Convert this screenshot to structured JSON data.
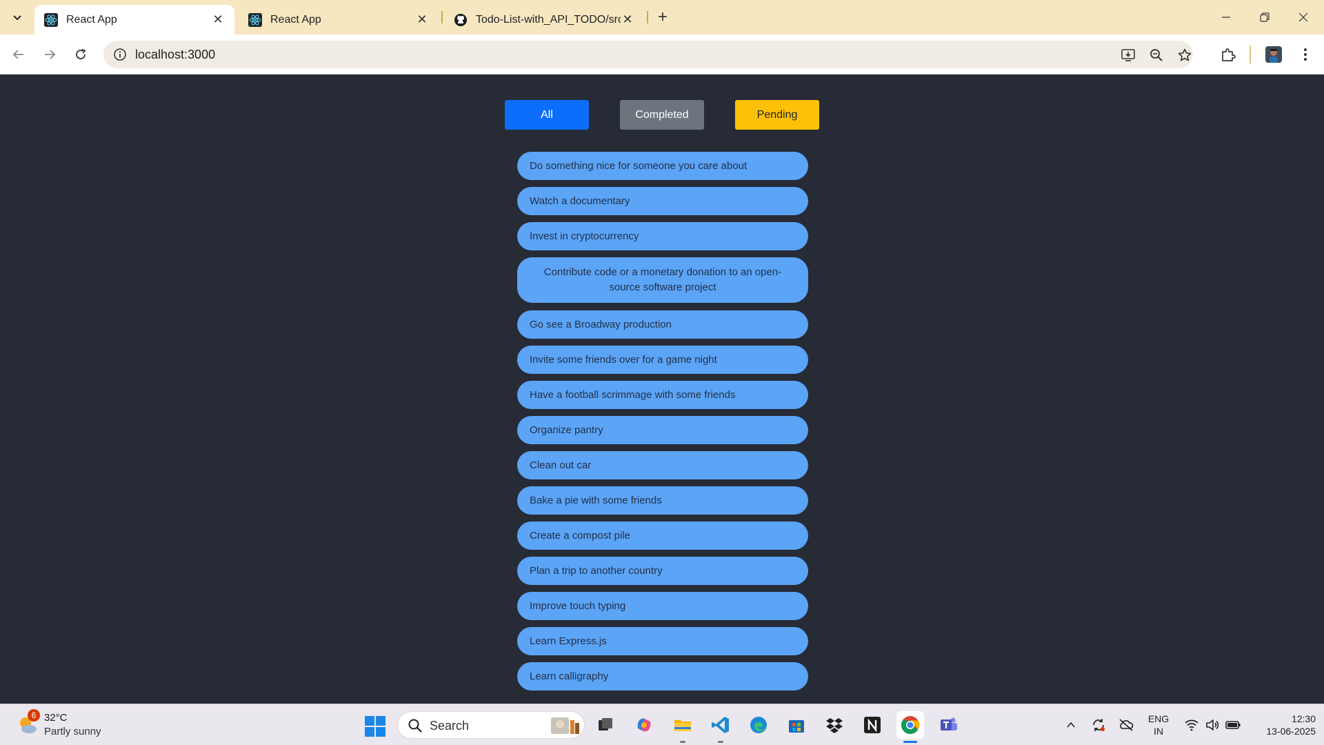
{
  "browser": {
    "tabs": [
      {
        "title": "React App",
        "icon": "react-icon",
        "active": true
      },
      {
        "title": "React App",
        "icon": "react-icon",
        "active": false
      },
      {
        "title": "Todo-List-with_API_TODO/src/c",
        "icon": "github-icon",
        "active": false
      }
    ],
    "new_tab": "+",
    "url": "localhost:3000",
    "colors": {
      "tabbar": "#f6e7c1",
      "active_tab": "#ffffff"
    }
  },
  "page": {
    "filters": {
      "all": "All",
      "completed": "Completed",
      "pending": "Pending"
    },
    "todos": [
      "Do something nice for someone you care about",
      "Watch a documentary",
      "Invest in cryptocurrency",
      "Contribute code or a monetary donation to an open-source software project",
      "Go see a Broadway production",
      "Invite some friends over for a game night",
      "Have a football scrimmage with some friends",
      "Organize pantry",
      "Clean out car",
      "Bake a pie with some friends",
      "Create a compost pile",
      "Plan a trip to another country",
      "Improve touch typing",
      "Learn Express.js",
      "Learn calligraphy"
    ],
    "colors": {
      "background": "#272b35",
      "todo": "#5ba4f6",
      "all": "#0d6efd",
      "completed": "#6c757d",
      "pending": "#ffc107"
    }
  },
  "taskbar": {
    "weather": {
      "badge": "6",
      "temp": "32°C",
      "desc": "Partly sunny"
    },
    "search_label": "Search",
    "lang_line1": "ENG",
    "lang_line2": "IN",
    "time": "12:30",
    "date": "13-06-2025"
  }
}
